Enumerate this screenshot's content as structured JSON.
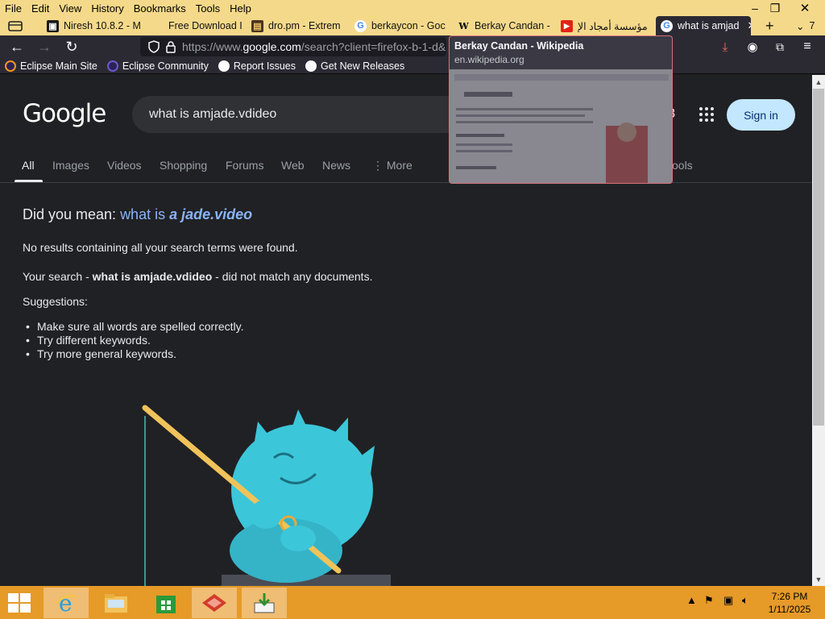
{
  "menubar": {
    "items": [
      "File",
      "Edit",
      "View",
      "History",
      "Bookmarks",
      "Tools",
      "Help"
    ]
  },
  "window_controls": {
    "minimize": "–",
    "restore": "❐",
    "close": "✕"
  },
  "tabs": [
    {
      "title": "Niresh 10.8.2 - M",
      "icon": "niresh-icon"
    },
    {
      "title": "Free Download I",
      "icon": "download-icon"
    },
    {
      "title": "dro.pm - Extrem",
      "icon": "dropm-icon"
    },
    {
      "title": "berkaycon - Goc",
      "icon": "google-icon"
    },
    {
      "title": "Berkay Candan -",
      "icon": "wikipedia-icon"
    },
    {
      "title": "مؤسسة أمجاد الإ",
      "icon": "youtube-icon"
    },
    {
      "title": "what is amjad",
      "icon": "google-icon",
      "active": true
    }
  ],
  "tab_overflow": {
    "new_tab": "+",
    "list_count": "7"
  },
  "navbar": {
    "url_prefix": "https://www.",
    "url_domain": "google.com",
    "url_rest": "/search?client=firefox-b-1-d&"
  },
  "bookmarks": [
    {
      "label": "Eclipse Main Site",
      "icon": "eclipse-icon"
    },
    {
      "label": "Eclipse Community",
      "icon": "eclipse-icon"
    },
    {
      "label": "Report Issues",
      "icon": "github-icon"
    },
    {
      "label": "Get New Releases",
      "icon": "github-icon"
    }
  ],
  "google": {
    "logo": "Google",
    "query": "what is amjade.vdideo",
    "sign_in": "Sign in",
    "tabs": [
      "All",
      "Images",
      "Videos",
      "Shopping",
      "Forums",
      "Web",
      "News",
      "⋮ More"
    ],
    "tools": "ools",
    "did_you_mean_label": "Did you mean: ",
    "did_you_mean_plain": "what is ",
    "did_you_mean_bold": "a jade.video",
    "no_results": "No results containing all your search terms were found.",
    "your_search_prefix": "Your search - ",
    "your_search_query": "what is amjade.vdideo",
    "your_search_suffix": " - did not match any documents.",
    "suggestions_label": "Suggestions:",
    "suggestions": [
      "Make sure all words are spelled correctly.",
      "Try different keywords.",
      "Try more general keywords."
    ]
  },
  "preview": {
    "title": "Berkay Candan - Wikipedia",
    "url": "en.wikipedia.org"
  },
  "taskbar": {
    "time": "7:26 PM",
    "date": "1/11/2025"
  },
  "colors": {
    "window_frame": "#f5d98a",
    "browser_toolbar": "#2b2a33",
    "page_bg": "#202124",
    "link": "#8ab4f8",
    "sign_in_bg": "#c2e7ff",
    "taskbar": "#e69a28",
    "monster": "#3cc6d9"
  }
}
